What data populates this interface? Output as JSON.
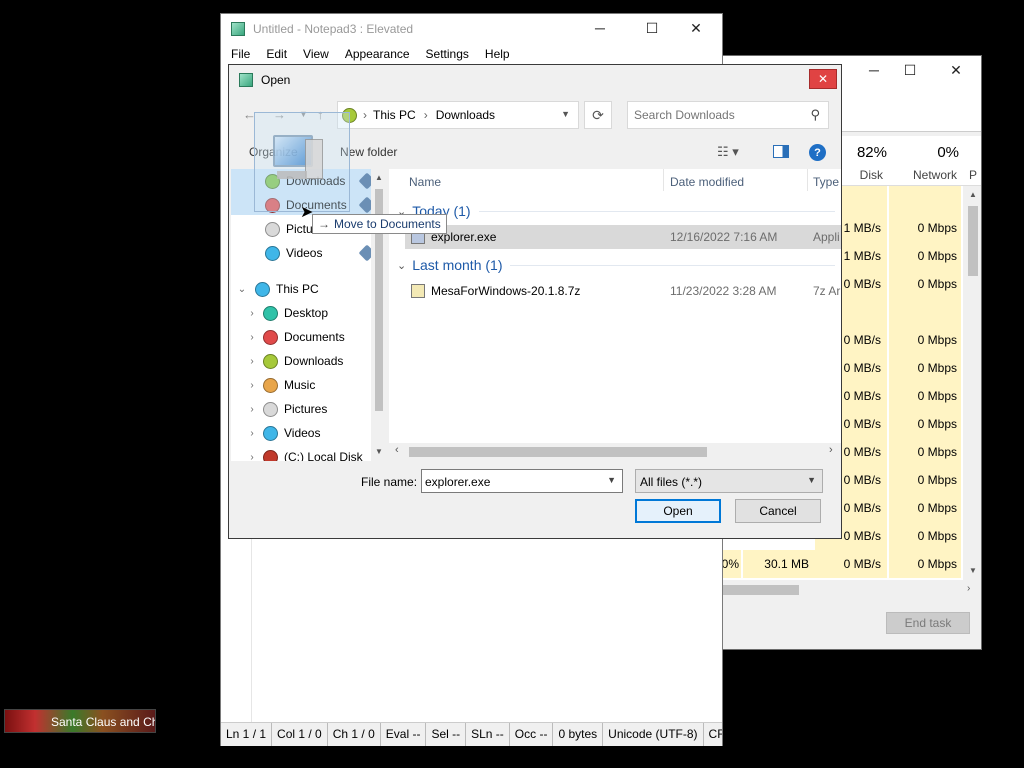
{
  "notepad": {
    "title": "Untitled - Notepad3 : Elevated",
    "menu": [
      "File",
      "Edit",
      "View",
      "Appearance",
      "Settings",
      "Help"
    ],
    "status": [
      "Ln 1 / 1",
      "Col 1 / 0",
      "Ch 1 / 0",
      "Eval --",
      "Sel --",
      "SLn --",
      "Occ --",
      "0 bytes",
      "Unicode (UTF-8)",
      "CR+"
    ]
  },
  "taskmgr": {
    "disk_pct": "82%",
    "disk_label": "Disk",
    "network_pct": "0%",
    "network_label": "Network",
    "p_label": "P",
    "rows": [
      {
        "disk": "",
        "net": ""
      },
      {
        "disk": "1 MB/s",
        "net": "0 Mbps"
      },
      {
        "disk": "1 MB/s",
        "net": "0 Mbps"
      },
      {
        "disk": "0 MB/s",
        "net": "0 Mbps"
      },
      {
        "disk": "",
        "net": ""
      },
      {
        "disk": "0 MB/s",
        "net": "0 Mbps"
      },
      {
        "disk": "0 MB/s",
        "net": "0 Mbps"
      },
      {
        "disk": "0 MB/s",
        "net": "0 Mbps"
      },
      {
        "disk": "0 MB/s",
        "net": "0 Mbps"
      },
      {
        "disk": "0 MB/s",
        "net": "0 Mbps"
      },
      {
        "disk": "0 MB/s",
        "net": "0 Mbps"
      },
      {
        "disk": "0 MB/s",
        "net": "0 Mbps"
      },
      {
        "disk": "0 MB/s",
        "net": "0 Mbps"
      }
    ],
    "last_mem": "30.1 MB",
    "last_pct": "0%",
    "end_task": "End task"
  },
  "dialog": {
    "title": "Open",
    "breadcrumb": [
      "This PC",
      "Downloads"
    ],
    "search_placeholder": "Search Downloads",
    "organize": "Organize",
    "new_folder": "New folder",
    "quick_access": [
      {
        "label": "Downloads",
        "color": "#7cc242"
      },
      {
        "label": "Documents",
        "color": "#e04a4a"
      },
      {
        "label": "Pictures",
        "color": "#d9d9d9"
      },
      {
        "label": "Videos",
        "color": "#3fb6e8"
      }
    ],
    "this_pc": "This PC",
    "pc_items": [
      {
        "label": "Desktop",
        "color": "#2fc2a8"
      },
      {
        "label": "Documents",
        "color": "#e04a4a"
      },
      {
        "label": "Downloads",
        "color": "#a6c93a"
      },
      {
        "label": "Music",
        "color": "#e8a54a"
      },
      {
        "label": "Pictures",
        "color": "#d9d9d9"
      },
      {
        "label": "Videos",
        "color": "#3fb6e8"
      },
      {
        "label": "(C:) Local Disk",
        "color": "#c0392b"
      }
    ],
    "drag_tooltip": "Move to Documents",
    "columns": {
      "name": "Name",
      "date": "Date modified",
      "type": "Type"
    },
    "groups": [
      {
        "label": "Today (1)",
        "files": [
          {
            "name": "explorer.exe",
            "date": "12/16/2022 7:16 AM",
            "type": "Appli"
          }
        ]
      },
      {
        "label": "Last month (1)",
        "files": [
          {
            "name": "MesaForWindows-20.1.8.7z",
            "date": "11/23/2022 3:28 AM",
            "type": "7z Ar"
          }
        ]
      }
    ],
    "file_name_label": "File name:",
    "file_name_value": "explorer.exe",
    "file_type": "All files (*.*)",
    "open_label": "Open",
    "cancel_label": "Cancel"
  },
  "taskbar_thumb": "Santa Claus and Ch",
  "colors": {
    "accent": "#0078d7",
    "heat": "#fff4c4",
    "close_red": "#e81123"
  }
}
